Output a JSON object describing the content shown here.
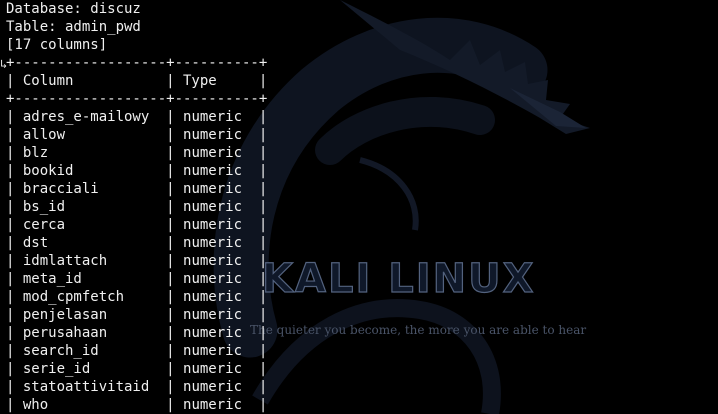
{
  "desktop": {
    "brand_title": "KALI LINUX",
    "tagline": "The quieter you become, the more you are able to hear",
    "logo_icon": "kali-dragon-icon",
    "colors": {
      "background": "#000000",
      "dragon": "#131a28",
      "text": "#f0f0f0"
    }
  },
  "terminal": {
    "database_line": "Database: discuz",
    "table_line": "Table: admin_pwd",
    "columns_count_line": "[17 columns]",
    "border_line": "+------------------+----------+",
    "header_line": "| Column           | Type     |",
    "rows": [
      {
        "column": "adres_e-mailowy",
        "type": "numeric"
      },
      {
        "column": "allow",
        "type": "numeric"
      },
      {
        "column": "blz",
        "type": "numeric"
      },
      {
        "column": "bookid",
        "type": "numeric"
      },
      {
        "column": "bracciali",
        "type": "numeric"
      },
      {
        "column": "bs_id",
        "type": "numeric"
      },
      {
        "column": "cerca",
        "type": "numeric"
      },
      {
        "column": "dst",
        "type": "numeric"
      },
      {
        "column": "idmlattach",
        "type": "numeric"
      },
      {
        "column": "meta_id",
        "type": "numeric"
      },
      {
        "column": "mod_cpmfetch",
        "type": "numeric"
      },
      {
        "column": "penjelasan",
        "type": "numeric"
      },
      {
        "column": "perusahaan",
        "type": "numeric"
      },
      {
        "column": "search_id",
        "type": "numeric"
      },
      {
        "column": "serie_id",
        "type": "numeric"
      },
      {
        "column": "statoattivitaid",
        "type": "numeric"
      },
      {
        "column": "who",
        "type": "numeric"
      }
    ]
  }
}
